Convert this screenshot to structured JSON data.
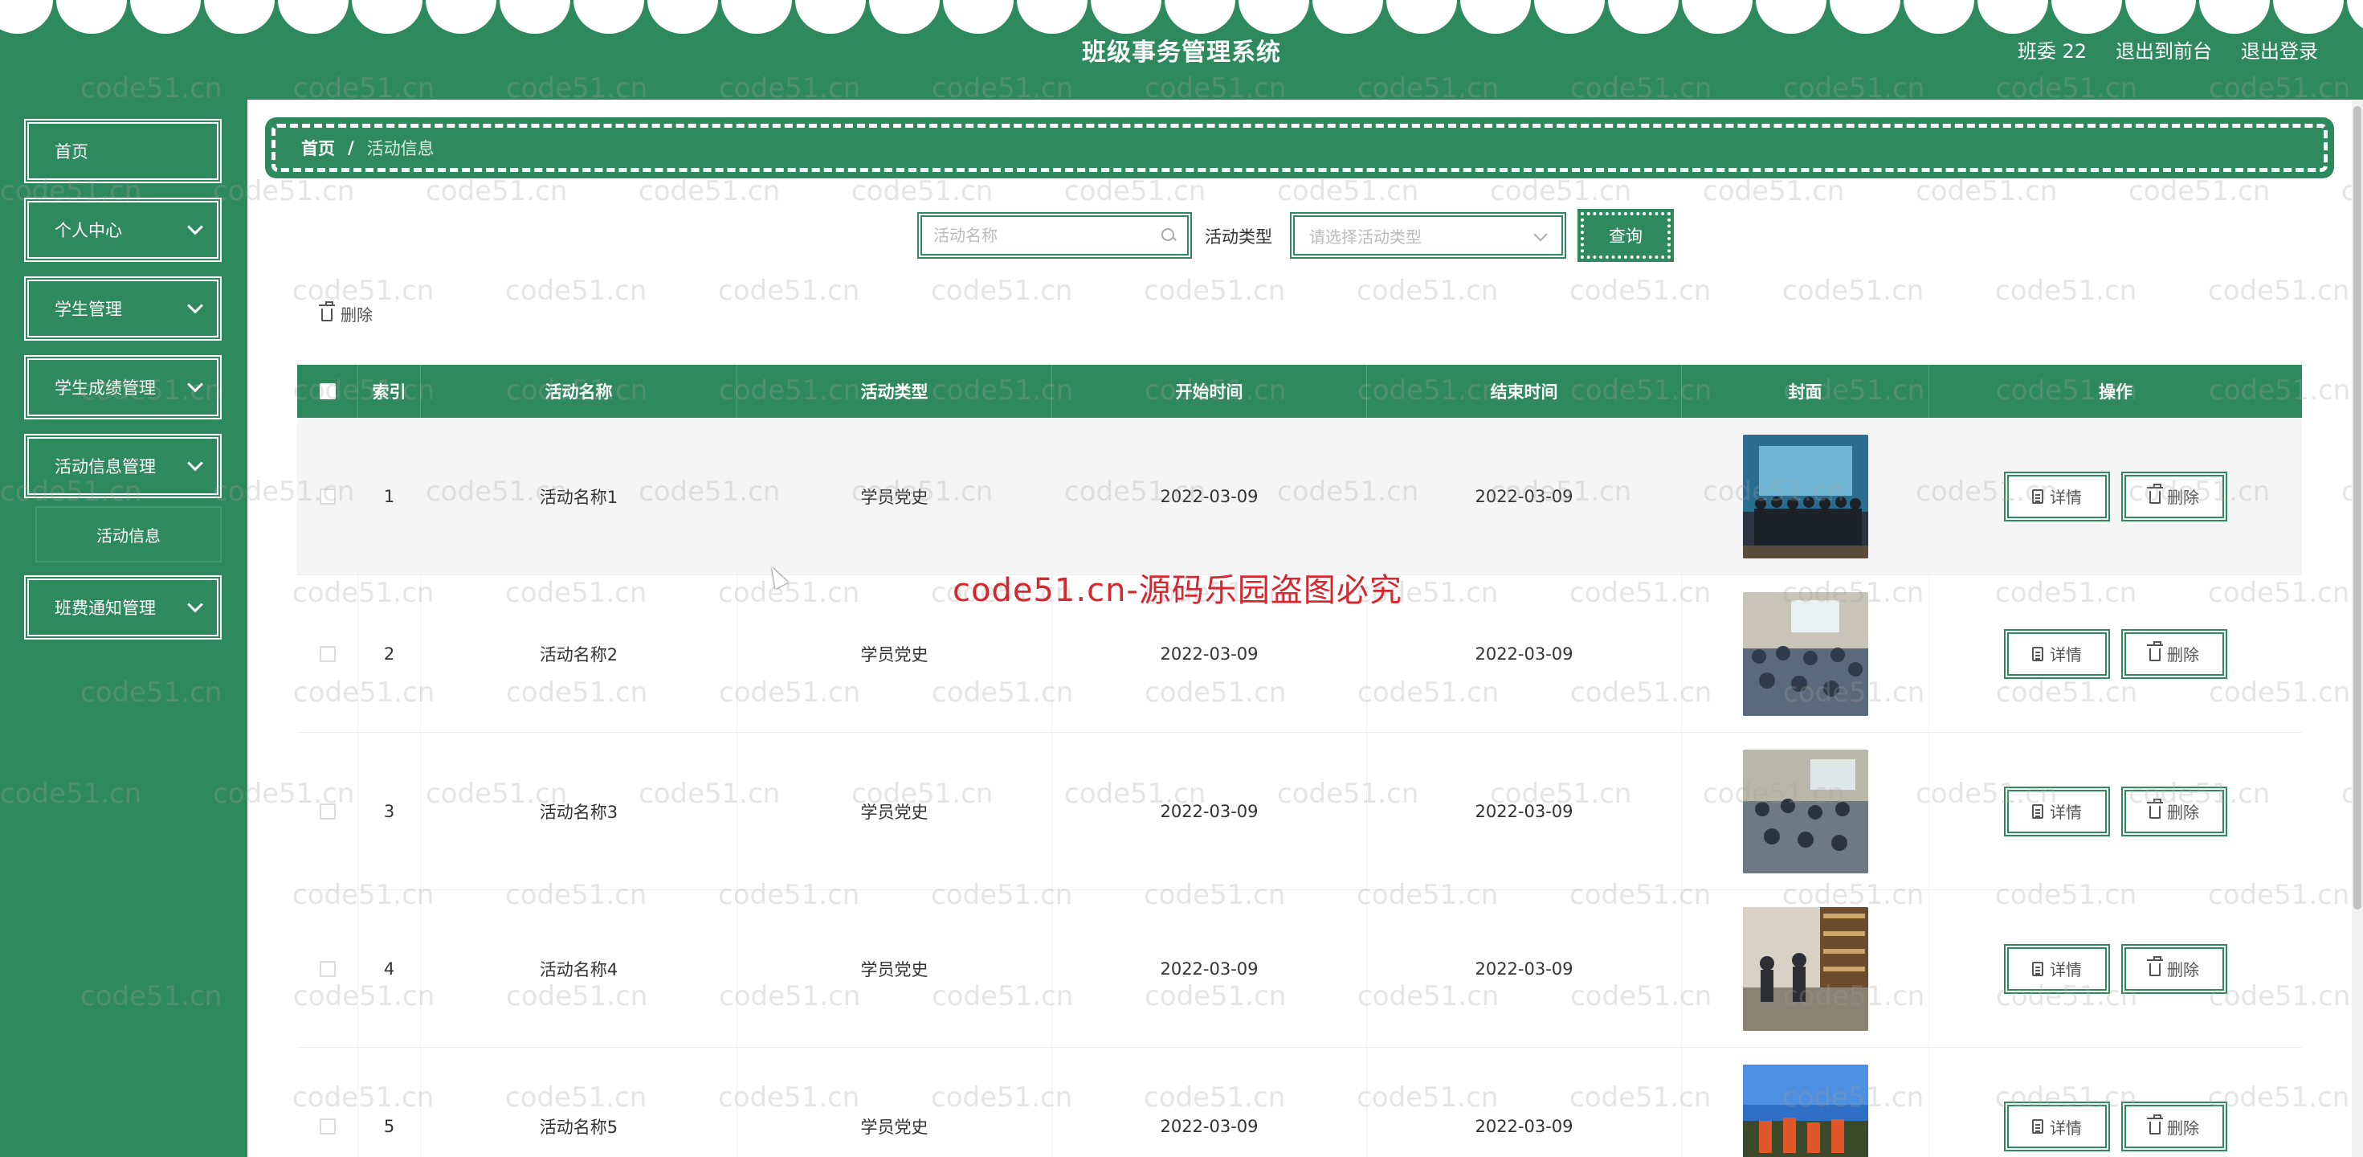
{
  "header": {
    "title": "班级事务管理系统",
    "user_label": "班委 22",
    "back_front_label": "退出到前台",
    "logout_label": "退出登录"
  },
  "sidebar": {
    "items": [
      {
        "label": "首页",
        "expandable": false
      },
      {
        "label": "个人中心",
        "expandable": true
      },
      {
        "label": "学生管理",
        "expandable": true
      },
      {
        "label": "学生成绩管理",
        "expandable": true
      },
      {
        "label": "活动信息管理",
        "expandable": true
      },
      {
        "label": "班费通知管理",
        "expandable": true
      }
    ],
    "subitem_label": "活动信息"
  },
  "breadcrumb": {
    "home": "首页",
    "separator": "/",
    "current": "活动信息"
  },
  "search": {
    "name_placeholder": "活动名称",
    "type_label": "活动类型",
    "type_placeholder": "请选择活动类型",
    "query_label": "查询",
    "batch_delete_label": "删除"
  },
  "table": {
    "headers": [
      "索引",
      "活动名称",
      "活动类型",
      "开始时间",
      "结束时间",
      "封面",
      "操作"
    ],
    "rows": [
      {
        "index": "1",
        "name": "活动名称1",
        "type": "学员党史",
        "start": "2022-03-09",
        "end": "2022-03-09"
      },
      {
        "index": "2",
        "name": "活动名称2",
        "type": "学员党史",
        "start": "2022-03-09",
        "end": "2022-03-09"
      },
      {
        "index": "3",
        "name": "活动名称3",
        "type": "学员党史",
        "start": "2022-03-09",
        "end": "2022-03-09"
      },
      {
        "index": "4",
        "name": "活动名称4",
        "type": "学员党史",
        "start": "2022-03-09",
        "end": "2022-03-09"
      },
      {
        "index": "5",
        "name": "活动名称5",
        "type": "学员党史",
        "start": "2022-03-09",
        "end": "2022-03-09"
      }
    ],
    "detail_label": "详情",
    "delete_label": "删除"
  },
  "watermark": {
    "text": "code51.cn",
    "banner": "code51.cn-源码乐园盗图必究"
  },
  "colors": {
    "primary": "#2e8a5c",
    "banner": "#d6262e"
  }
}
